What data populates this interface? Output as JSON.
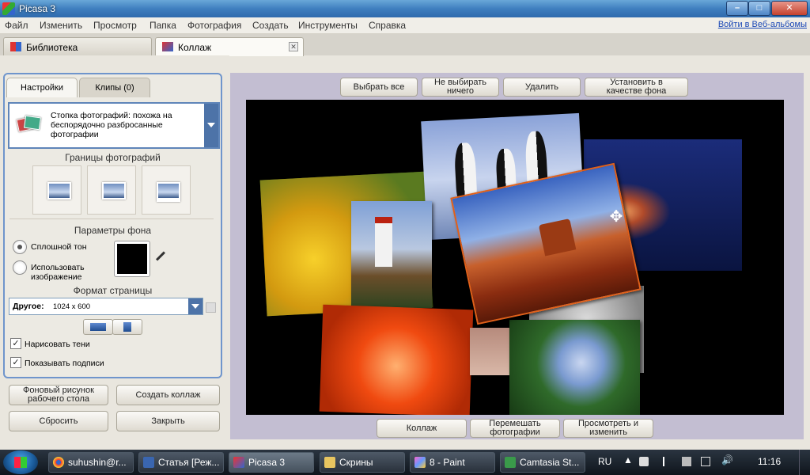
{
  "window": {
    "title": "Picasa 3",
    "min": "–",
    "max": "□",
    "close": "✕"
  },
  "menu": [
    "Файл",
    "Изменить",
    "Просмотр",
    "Папка",
    "Фотография",
    "Создать",
    "Инструменты",
    "Справка"
  ],
  "web_link": "Войти в Веб-альбомы",
  "tabs": {
    "library": "Библиотека",
    "collage": "Коллаж",
    "close": "✕"
  },
  "panel": {
    "tab_settings": "Настройки",
    "tab_clips": "Клипы (0)",
    "style_text": "Стопка фотографий: похожа на беспорядочно разбросанные фотографии",
    "borders_title": "Границы фотографий",
    "bg_title": "Параметры фона",
    "solid": "Сплошной тон",
    "use_image": "Использовать изображение",
    "page_format_title": "Формат страницы",
    "format_bold": "Другое:",
    "format_value": "1024 x 600",
    "draw_shadows": "Нарисовать тени",
    "show_captions": "Показывать подписи",
    "check": "✓"
  },
  "bottom_buttons": {
    "wallpaper": "Фоновый рисунок рабочего стола",
    "create": "Создать коллаж",
    "reset": "Сбросить",
    "close": "Закрыть"
  },
  "top_buttons": {
    "select_all": "Выбрать все",
    "select_none": "Не выбирать ничего",
    "delete": "Удалить",
    "set_bg": "Установить в качестве фона"
  },
  "under_buttons": {
    "collage": "Коллаж",
    "shuffle": "Перемешать фотографии",
    "view_edit": "Просмотреть и изменить"
  },
  "taskbar": {
    "items": [
      "suhushin@r...",
      "Статья [Реж...",
      "Picasa 3",
      "Скрины",
      "8 - Paint",
      "Camtasia St..."
    ],
    "lang": "RU",
    "time": "11:16"
  }
}
